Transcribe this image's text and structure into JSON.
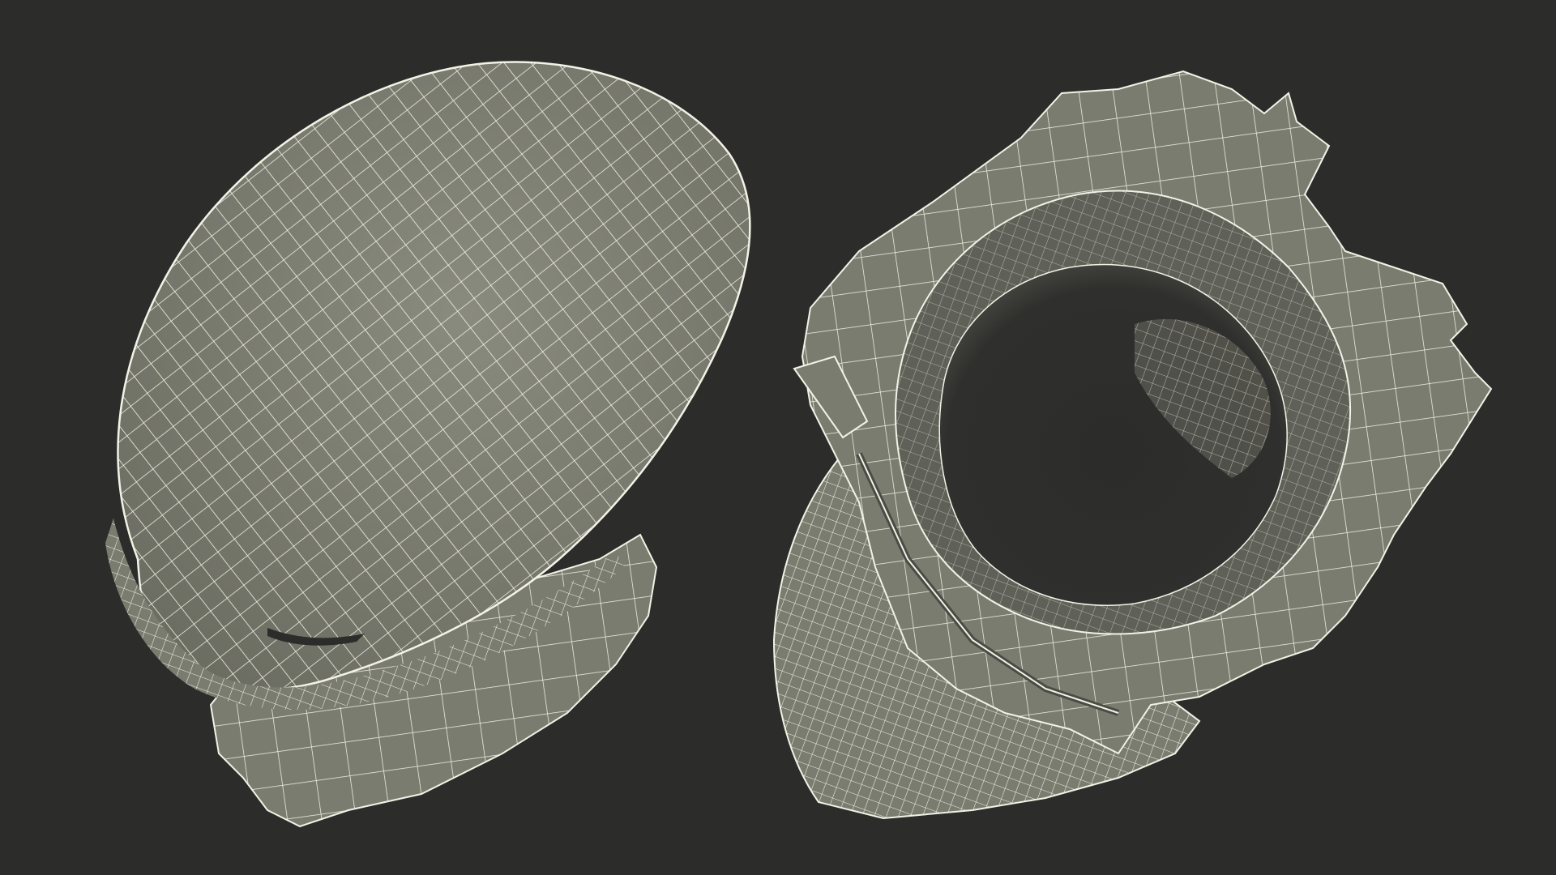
{
  "scene": {
    "colors": {
      "background": "#2c2c2b",
      "surface": "#7b7c70",
      "surface_light": "#8a8b7f",
      "surface_dark": "#5f6057",
      "cavity": "#2c2c2b",
      "wire": "#f2f2e6"
    },
    "objects": [
      "closed-shell-object",
      "open-shell-object"
    ]
  }
}
